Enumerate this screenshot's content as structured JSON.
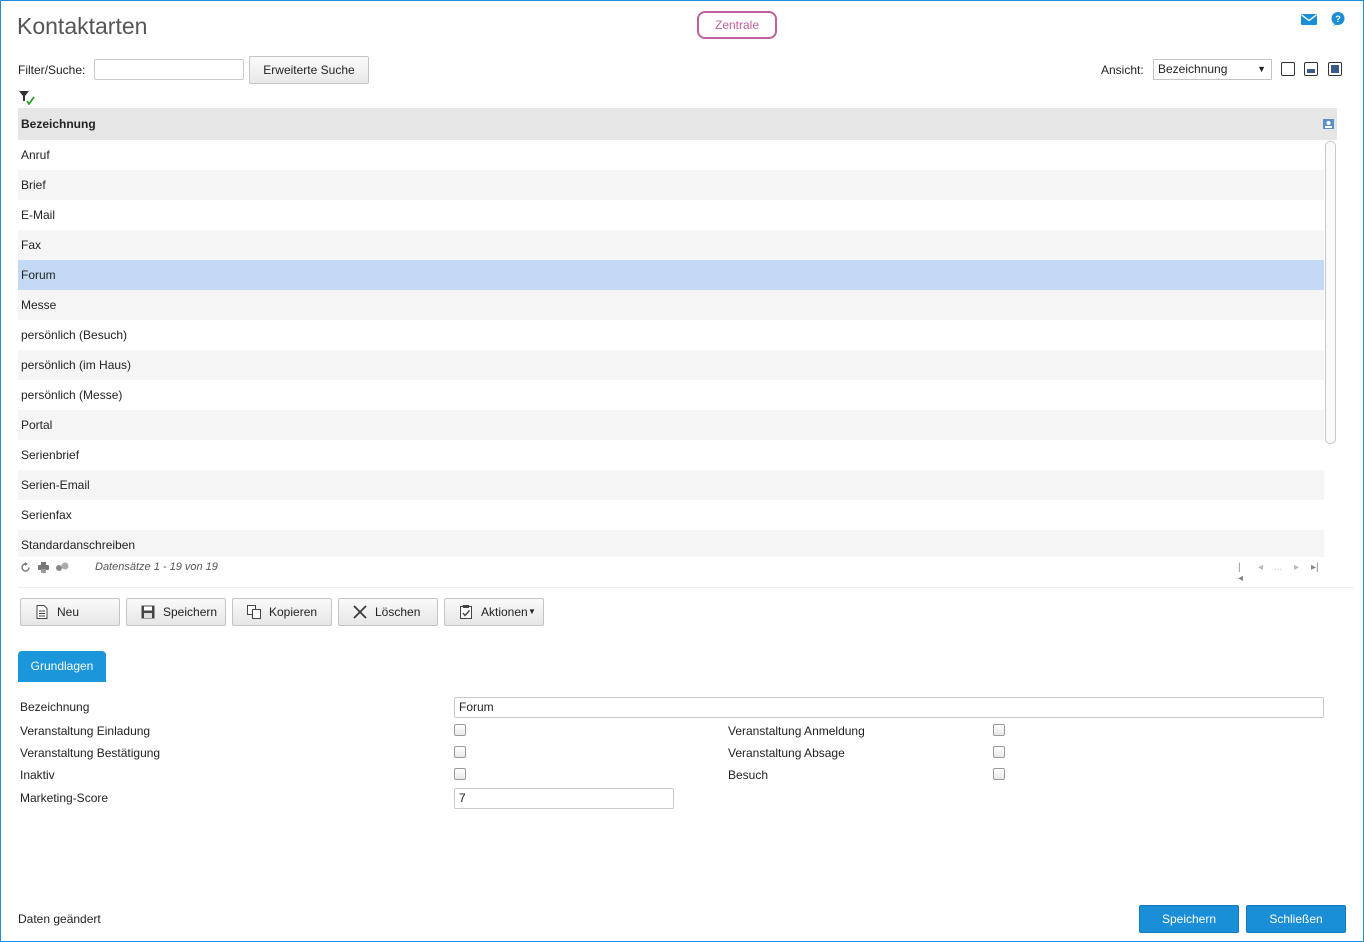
{
  "page": {
    "title": "Kontaktarten",
    "location_badge": "Zentrale"
  },
  "header_icons": [
    "mail-icon",
    "help-icon"
  ],
  "search": {
    "label": "Filter/Suche:",
    "value": "",
    "extended_button": "Erweiterte Suche"
  },
  "view": {
    "label": "Ansicht:",
    "selected": "Bezeichnung"
  },
  "grid": {
    "header": "Bezeichnung",
    "rows": [
      "Anruf",
      "Brief",
      "E-Mail",
      "Fax",
      "Forum",
      "Messe",
      "persönlich (Besuch)",
      "persönlich (im Haus)",
      "persönlich (Messe)",
      "Portal",
      "Serienbrief",
      "Serien-Email",
      "Serienfax",
      "Standardanschreiben"
    ],
    "selected_row": "Forum",
    "records_text": "Datensätze 1 - 19 von 19",
    "pager_ellipsis": "..."
  },
  "actions": {
    "new": "Neu",
    "save": "Speichern",
    "copy": "Kopieren",
    "delete": "Löschen",
    "actions": "Aktionen"
  },
  "tabs": {
    "basics": "Grundlagen"
  },
  "form": {
    "bezeichnung_label": "Bezeichnung",
    "bezeichnung_value": "Forum",
    "einladung_label": "Veranstaltung Einladung",
    "anmeldung_label": "Veranstaltung Anmeldung",
    "bestaetigung_label": "Veranstaltung Bestätigung",
    "absage_label": "Veranstaltung Absage",
    "inaktiv_label": "Inaktiv",
    "besuch_label": "Besuch",
    "score_label": "Marketing-Score",
    "score_value": "7"
  },
  "status": {
    "text": "Daten geändert"
  },
  "footer_buttons": {
    "save": "Speichern",
    "close": "Schließen"
  },
  "colors": {
    "accent": "#1a8ed6",
    "badge": "#c0609a",
    "selected_row": "#c4d9f5"
  }
}
